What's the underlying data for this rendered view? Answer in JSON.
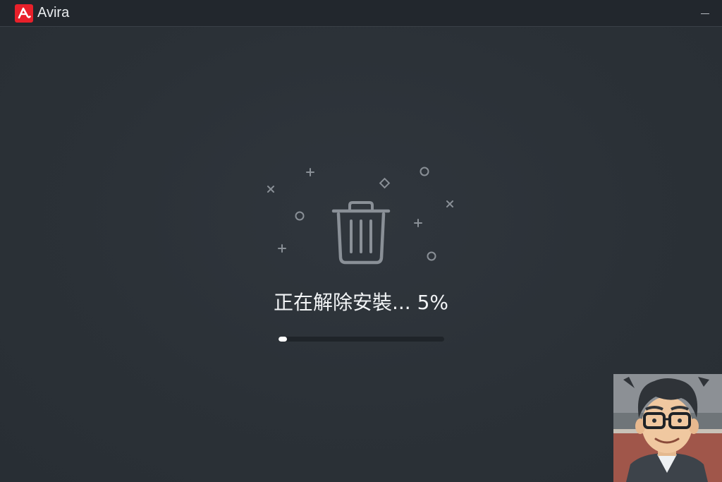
{
  "window": {
    "app_name": "Avira",
    "logo_icon": "avira-umbrella-logo-icon",
    "minimize_icon": "minimize-icon",
    "accent_color": "#e8202a"
  },
  "main": {
    "illustration_icon": "trash-can-icon",
    "decorations": [
      "plus-icon",
      "x-icon",
      "circle-icon",
      "diamond-icon"
    ],
    "status_label": "正在解除安裝...",
    "progress_text": "5%",
    "progress_value": 0.05
  },
  "overlay": {
    "webcam_icon": "cartoon-avatar-webcam"
  }
}
